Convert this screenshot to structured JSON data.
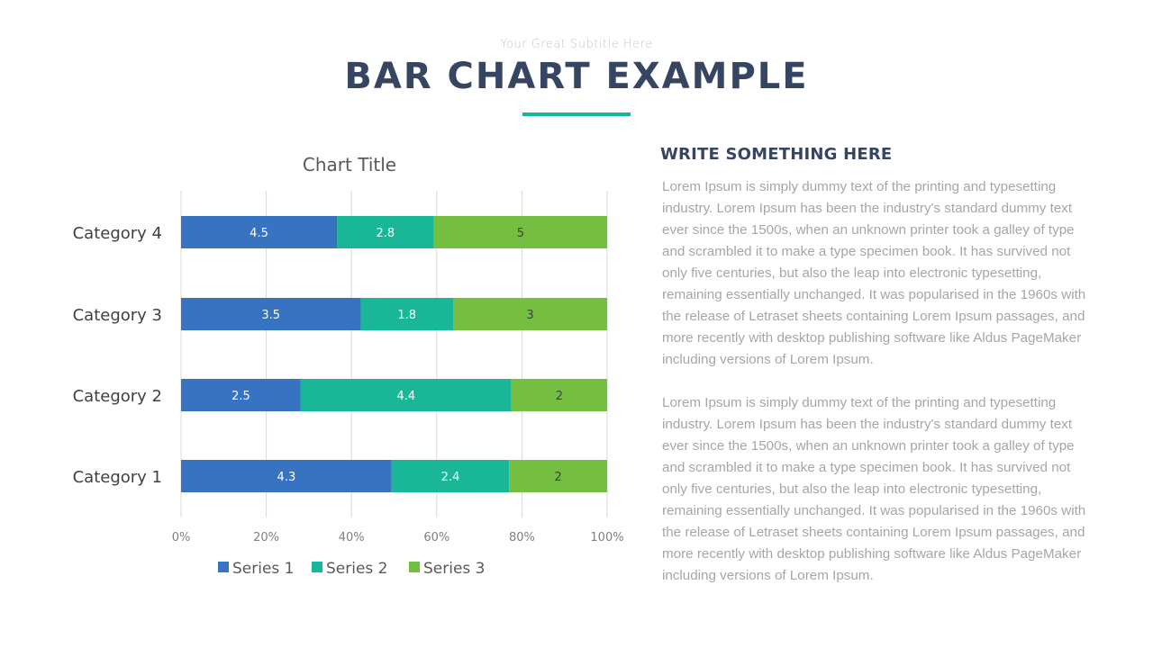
{
  "header": {
    "subtitle": "Your Great Subtitle Here",
    "title": "BAR CHART EXAMPLE",
    "accent_color": "#19b797",
    "title_color": "#364562"
  },
  "side_panel": {
    "heading": "WRITE SOMETHING HERE",
    "paragraphs": [
      "Lorem Ipsum is simply dummy text of the printing and typesetting industry. Lorem Ipsum has been the industry's standard dummy text ever since the 1500s, when an unknown printer took a galley of type and scrambled it to make a type specimen book. It has survived not only five centuries, but also the leap into electronic typesetting, remaining essentially unchanged. It was popularised in the 1960s with the release of Letraset sheets containing Lorem Ipsum passages, and more recently with desktop publishing software like Aldus PageMaker including versions of Lorem Ipsum.",
      "Lorem Ipsum is simply dummy text of the printing and typesetting industry. Lorem Ipsum has been the industry's standard dummy text ever since the 1500s, when an unknown printer took a galley of type and scrambled it to make a type specimen book. It has survived not only five centuries, but also the leap into electronic typesetting, remaining essentially unchanged. It was popularised in the 1960s with the release of Letraset sheets containing Lorem Ipsum passages, and more recently with desktop publishing software like Aldus PageMaker including versions of Lorem Ipsum."
    ]
  },
  "chart_data": {
    "type": "bar",
    "orientation": "horizontal",
    "stacking": "percent",
    "title": "Chart Title",
    "categories": [
      "Category 1",
      "Category 2",
      "Category 3",
      "Category 4"
    ],
    "series": [
      {
        "name": "Series 1",
        "color": "#3773c1",
        "label_color": "#ffffff",
        "values": [
          4.3,
          2.5,
          3.5,
          4.5
        ]
      },
      {
        "name": "Series 2",
        "color": "#19b797",
        "label_color": "#ffffff",
        "values": [
          2.4,
          4.4,
          1.8,
          2.8
        ]
      },
      {
        "name": "Series 3",
        "color": "#74be42",
        "label_color": "#404040",
        "values": [
          2,
          2,
          3,
          5
        ]
      }
    ],
    "xlabel": "",
    "ylabel": "",
    "xlim": [
      0,
      100
    ],
    "x_ticks": [
      "0%",
      "20%",
      "40%",
      "60%",
      "80%",
      "100%"
    ],
    "grid": true,
    "legend": "bottom",
    "data_labels": true
  }
}
